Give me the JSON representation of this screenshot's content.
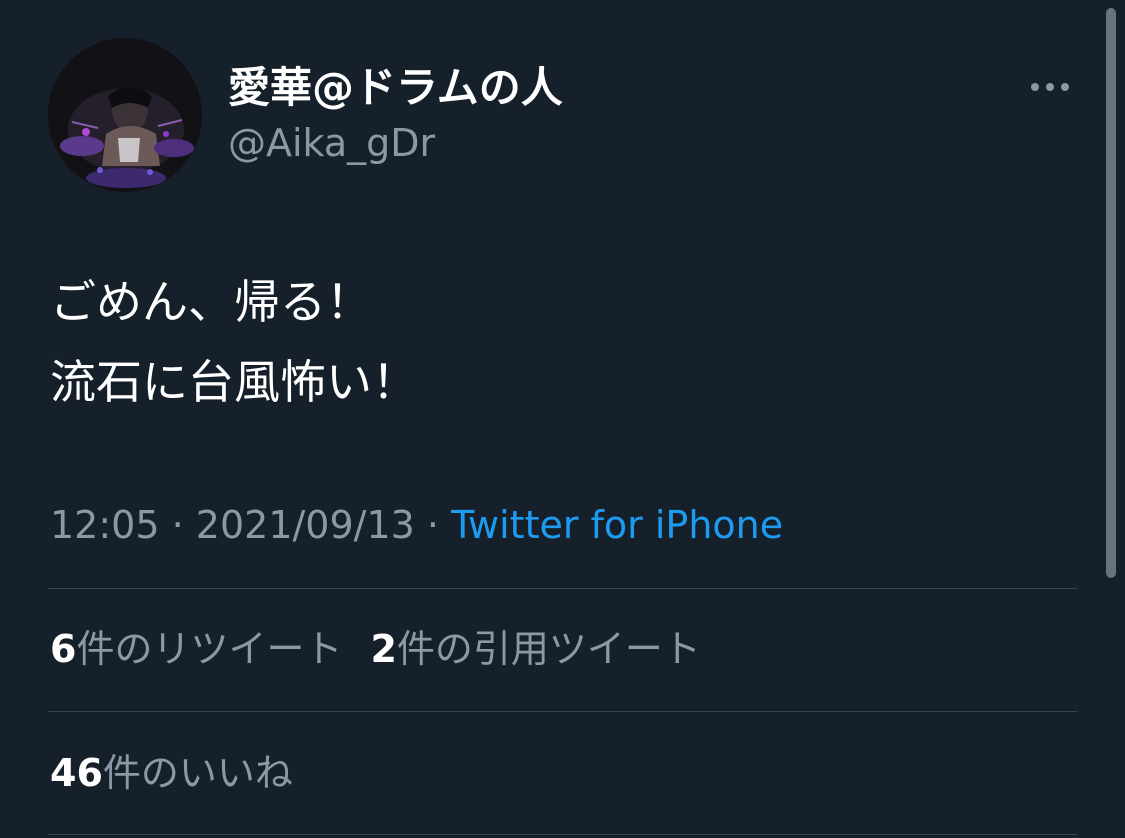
{
  "tweet": {
    "author": {
      "display_name": "愛華@ドラムの人",
      "handle": "@Aika_gDr"
    },
    "more_icon": "more-horizontal-icon",
    "text_lines": [
      "ごめん、帰る！",
      "流石に台風怖い！"
    ],
    "time": "12:05",
    "separator": "·",
    "date": "2021/09/13",
    "source": "Twitter for iPhone",
    "stats": {
      "retweets_count": "6",
      "retweets_label": "件のリツイート",
      "quotes_count": "2",
      "quotes_label": "件の引用ツイート",
      "likes_count": "46",
      "likes_label": "件のいいね"
    }
  },
  "colors": {
    "background": "#15202b",
    "primary_text": "#ffffff",
    "secondary_text": "#8b98a5",
    "link": "#1d9bf0",
    "divider": "#38444d"
  }
}
